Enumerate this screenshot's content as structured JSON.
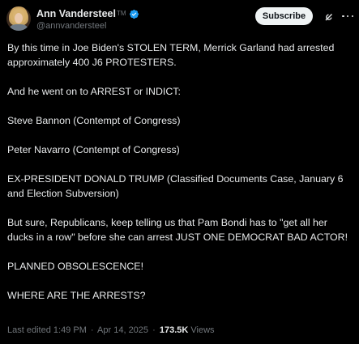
{
  "author": {
    "display_name": "Ann Vandersteel",
    "tm": "TM",
    "handle": "@annvandersteel",
    "verified_color": "#1d9bf0"
  },
  "actions": {
    "subscribe_label": "Subscribe",
    "grok_icon": "grok-icon",
    "more_icon": "more-icon"
  },
  "post": {
    "paragraphs": [
      "By this time in Joe Biden's STOLEN TERM, Merrick Garland had arrested approximately 400 J6 PROTESTERS.",
      "And he went on to ARREST or INDICT:",
      "Steve Bannon (Contempt of Congress)",
      "Peter Navarro (Contempt of Congress)",
      "EX-PRESIDENT DONALD TRUMP (Classified Documents Case, January 6 and Election Subversion)",
      "But sure, Republicans, keep telling us that Pam Bondi has to \"get all her ducks in a row\" before she can arrest JUST ONE DEMOCRAT BAD ACTOR!",
      "PLANNED OBSOLESCENCE!",
      "WHERE ARE THE ARRESTS?"
    ]
  },
  "meta": {
    "edited_label": "Last edited",
    "time": "1:49 PM",
    "separator": "·",
    "date": "Apr 14, 2025",
    "views_count": "173.5K",
    "views_label": "Views"
  },
  "colors": {
    "background": "#000000",
    "text": "#e7e9ea",
    "secondary": "#71767b",
    "button_bg": "#eff3f4"
  }
}
